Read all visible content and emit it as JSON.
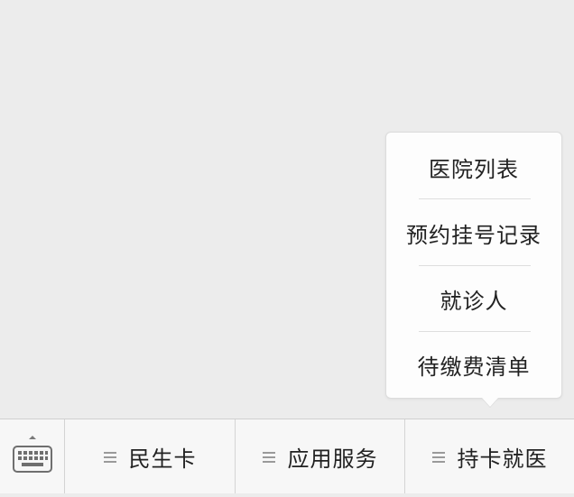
{
  "popup_menu": {
    "items": [
      {
        "label": "医院列表"
      },
      {
        "label": "预约挂号记录"
      },
      {
        "label": "就诊人"
      },
      {
        "label": "待缴费清单"
      }
    ]
  },
  "bottom_menu": {
    "items": [
      {
        "label": "民生卡"
      },
      {
        "label": "应用服务"
      },
      {
        "label": "持卡就医"
      }
    ]
  },
  "icons": {
    "keyboard": "keyboard-icon",
    "menu_lines": "menu-lines-icon"
  },
  "colors": {
    "background": "#ececec",
    "bar_background": "#f7f7f7",
    "popup_background": "#fdfdfd",
    "text": "#222222"
  }
}
